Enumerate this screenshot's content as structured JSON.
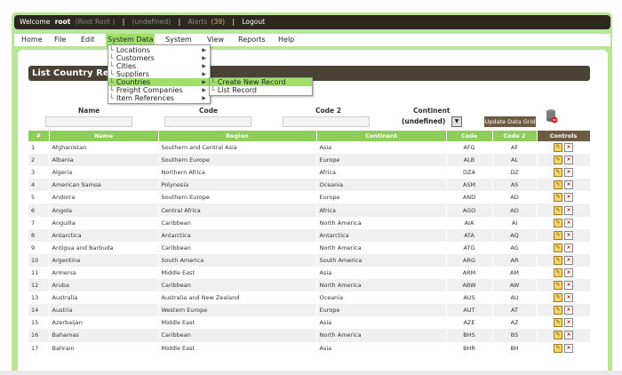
{
  "topbar": {
    "welcome": "Welcome",
    "user": "root",
    "role": "(Root Root )",
    "sep1": "|",
    "undefined_label": "(undefined)",
    "sep2": "|",
    "alerts_label": "Alerts",
    "alerts_count": "(39)",
    "sep3": "|",
    "logout": "Logout"
  },
  "menu": {
    "home": "Home",
    "file": "File",
    "edit": "Edit",
    "system_data": "System Data",
    "system": "System",
    "view": "View",
    "reports": "Reports",
    "help": "Help"
  },
  "dropdown": {
    "items": [
      "Locations",
      "Customers",
      "Cities",
      "Suppliers",
      "Countries",
      "Freight Companies",
      "Item References"
    ]
  },
  "submenu": {
    "items": [
      "Create New Record",
      "List Record"
    ]
  },
  "page": {
    "title": "List Country Rec"
  },
  "filters": {
    "name_label": "Name",
    "code_label": "Code",
    "code2_label": "Code 2",
    "continent_label": "Continent",
    "continent_value": "(undefined)",
    "update_button": "Update Data Grid"
  },
  "grid": {
    "headers": [
      "#",
      "Name",
      "Region",
      "Continent",
      "Code",
      "Code 2",
      "Controls"
    ],
    "rows": [
      [
        "1",
        "Afghanistan",
        "Southern and Central Asia",
        "Asia",
        "AFG",
        "AF"
      ],
      [
        "2",
        "Albania",
        "Southern Europe",
        "Europe",
        "ALB",
        "AL"
      ],
      [
        "3",
        "Algeria",
        "Northern Africa",
        "Africa",
        "DZA",
        "DZ"
      ],
      [
        "4",
        "American Samoa",
        "Polynesia",
        "Oceania",
        "ASM",
        "AS"
      ],
      [
        "5",
        "Andorra",
        "Southern Europe",
        "Europe",
        "AND",
        "AD"
      ],
      [
        "6",
        "Angola",
        "Central Africa",
        "Africa",
        "AGO",
        "AO"
      ],
      [
        "7",
        "Anguilla",
        "Caribbean",
        "North America",
        "AIA",
        "AI"
      ],
      [
        "8",
        "Antarctica",
        "Antarctica",
        "Antarctica",
        "ATA",
        "AQ"
      ],
      [
        "9",
        "Antigua and Barbuda",
        "Caribbean",
        "North America",
        "ATG",
        "AG"
      ],
      [
        "10",
        "Argentina",
        "South America",
        "South America",
        "ARG",
        "AR"
      ],
      [
        "11",
        "Armenia",
        "Middle East",
        "Asia",
        "ARM",
        "AM"
      ],
      [
        "12",
        "Aruba",
        "Caribbean",
        "North America",
        "ABW",
        "AW"
      ],
      [
        "13",
        "Australia",
        "Australia and New Zealand",
        "Oceania",
        "AUS",
        "AU"
      ],
      [
        "14",
        "Austria",
        "Western Europe",
        "Europe",
        "AUT",
        "AT"
      ],
      [
        "15",
        "Azerbaijan",
        "Middle East",
        "Asia",
        "AZE",
        "AZ"
      ],
      [
        "16",
        "Bahamas",
        "Caribbean",
        "North America",
        "BHS",
        "BS"
      ],
      [
        "17",
        "Bahrain",
        "Middle East",
        "Asia",
        "BHR",
        "BH"
      ]
    ]
  },
  "icons": {
    "edit": "edit-icon",
    "delete": "delete-icon",
    "export": "database-export-icon"
  },
  "colors": {
    "accent_green": "#8fcc5a",
    "dark_bar": "#2c271f",
    "title_bar": "#4a4235"
  }
}
